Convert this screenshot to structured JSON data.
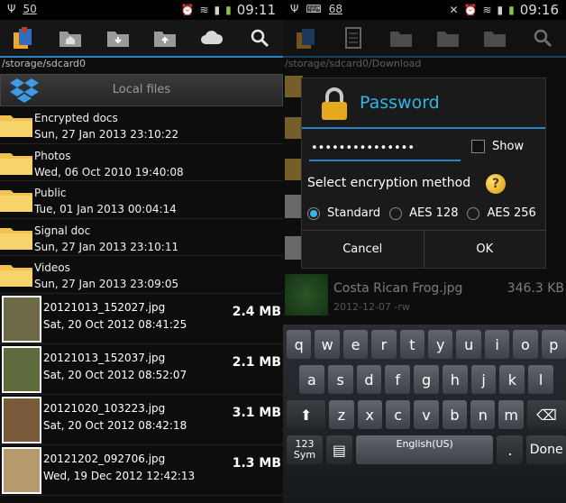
{
  "left": {
    "status": {
      "battery_badge": "50",
      "time": "09:11"
    },
    "toolbar_icons": [
      "app-logo-icon",
      "home-folder-icon",
      "download-folder-icon",
      "upload-folder-icon",
      "cloud-icon",
      "search-icon"
    ],
    "path": "/storage/sdcard0",
    "local_label": "Local files",
    "folders": [
      {
        "name": "Encrypted docs",
        "date": "Sun, 27 Jan 2013 23:10:22"
      },
      {
        "name": "Photos",
        "date": "Wed, 06 Oct 2010 19:40:08"
      },
      {
        "name": "Public",
        "date": "Tue, 01 Jan 2013 00:04:14"
      },
      {
        "name": "Signal doc",
        "date": "Sun, 27 Jan 2013 23:10:11"
      },
      {
        "name": "Videos",
        "date": "Sun, 27 Jan 2013 23:09:05"
      }
    ],
    "images": [
      {
        "name": "20121013_152027.jpg",
        "date": "Sat, 20 Oct 2012 08:41:25",
        "size": "2.4 MB",
        "color": "#6c6b45"
      },
      {
        "name": "20121013_152037.jpg",
        "date": "Sat, 20 Oct 2012 08:52:07",
        "size": "2.1 MB",
        "color": "#5f6b3c"
      },
      {
        "name": "20121020_103223.jpg",
        "date": "Sat, 20 Oct 2012 08:42:18",
        "size": "3.1 MB",
        "color": "#7a5a3b"
      },
      {
        "name": "20121202_092706.jpg",
        "date": "Wed, 19 Dec 2012 12:42:13",
        "size": "1.3 MB",
        "color": "#b49a6c"
      }
    ]
  },
  "right": {
    "status": {
      "battery_badge": "68",
      "time": "09:16"
    },
    "path": "/storage/sdcard0/Download",
    "bg_file": {
      "name": "Costa Rican Frog.jpg",
      "size": "346.3 KB",
      "meta": "2012-12-07 -rw",
      "meta2": "2012-12-07 -rw"
    },
    "dialog": {
      "title": "Password",
      "password_mask": "•••••••••••••••",
      "show_label": "Show",
      "select_label": "Select encryption method",
      "help_glyph": "?",
      "options": [
        "Standard",
        "AES 128",
        "AES 256"
      ],
      "selected": "Standard",
      "cancel_label": "Cancel",
      "ok_label": "OK"
    },
    "keyboard": {
      "row1": [
        "q",
        "w",
        "e",
        "r",
        "t",
        "y",
        "u",
        "i",
        "o",
        "p"
      ],
      "row2": [
        "a",
        "s",
        "d",
        "f",
        "g",
        "h",
        "j",
        "k",
        "l"
      ],
      "row3": [
        "z",
        "x",
        "c",
        "v",
        "b",
        "n",
        "m"
      ],
      "sym_label": "123\nSym",
      "space_label": "English(US)",
      "period": ".",
      "done_label": "Done"
    }
  },
  "colors": {
    "accent": "#2a84c4",
    "title": "#33b5e5"
  }
}
